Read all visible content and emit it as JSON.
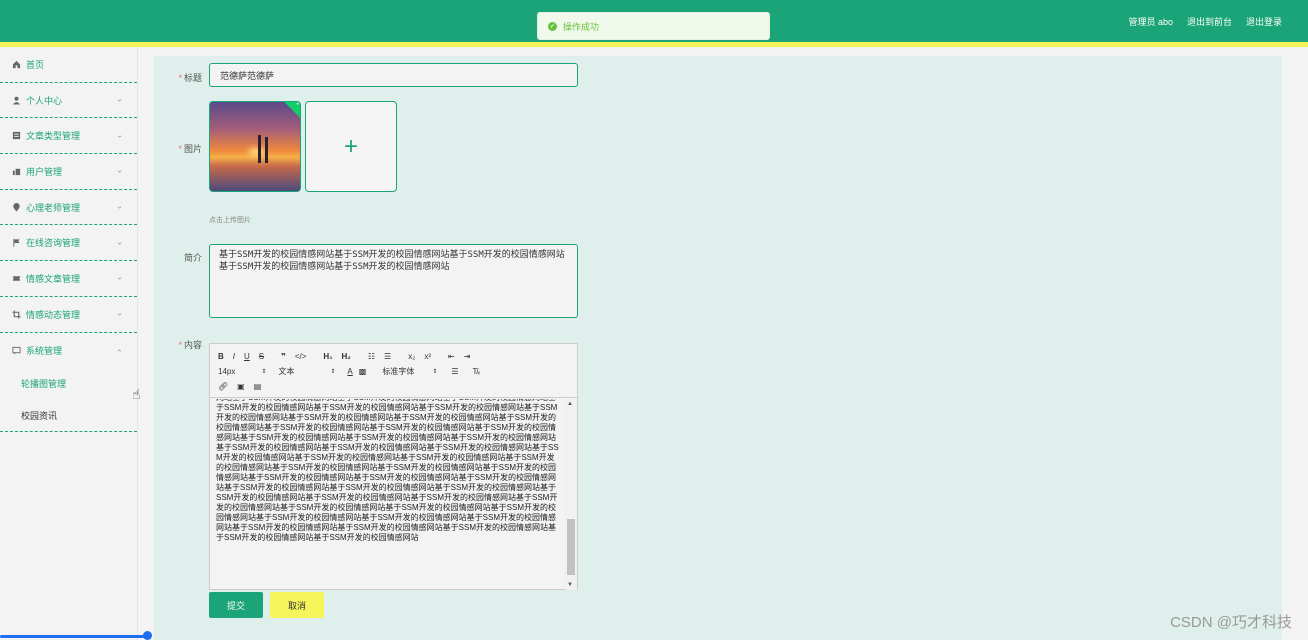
{
  "header": {
    "user_label": "管理员 abo",
    "back_to_front": "退出到前台",
    "logout": "退出登录"
  },
  "toast": {
    "message": "操作成功"
  },
  "sidebar": {
    "items": [
      {
        "label": "首页",
        "icon": "home-icon"
      },
      {
        "label": "个人中心",
        "icon": "user-icon"
      },
      {
        "label": "文章类型管理",
        "icon": "document-icon"
      },
      {
        "label": "用户管理",
        "icon": "users-icon"
      },
      {
        "label": "心理老师管理",
        "icon": "location-icon"
      },
      {
        "label": "在线咨询管理",
        "icon": "flag-icon"
      },
      {
        "label": "情感文章管理",
        "icon": "ticket-icon"
      },
      {
        "label": "情感动态管理",
        "icon": "crop-icon"
      },
      {
        "label": "系统管理",
        "icon": "message-icon"
      }
    ],
    "sub_items": [
      {
        "label": "轮播图管理"
      },
      {
        "label": "校园资讯"
      }
    ]
  },
  "form": {
    "title_label": "标题",
    "title_value": "范德萨范德萨",
    "image_label": "图片",
    "upload_hint": "点击上传图片",
    "summary_label": "简介",
    "summary_value": "基于SSM开发的校园情感网站基于SSM开发的校园情感网站基于SSM开发的校园情感网站基于SSM开发的校园情感网站基于SSM开发的校园情感网站",
    "content_label": "内容",
    "content_value": "网站基于SSM开发的校园情感网站基于SSM开发的校园情感网站基于SSM开发的校园情感网站基于SSM开发的校园情感网站基于SSM开发的校园情感网站基于SSM开发的校园情感网站基于SSM开发的校园情感网站基于SSM开发的校园情感网站基于SSM开发的校园情感网站基于SSM开发的校园情感网站基于SSM开发的校园情感网站基于SSM开发的校园情感网站基于SSM开发的校园情感网站基于SSM开发的校园情感网站基于SSM开发的校园情感网站基于SSM开发的校园情感网站基于SSM开发的校园情感网站基于SSM开发的校园情感网站基于SSM开发的校园情感网站基于SSM开发的校园情感网站基于SSM开发的校园情感网站基于SSM开发的校园情感网站基于SSM开发的校园情感网站基于SSM开发的校园情感网站基于SSM开发的校园情感网站基于SSM开发的校园情感网站基于SSM开发的校园情感网站基于SSM开发的校园情感网站基于SSM开发的校园情感网站基于SSM开发的校园情感网站基于SSM开发的校园情感网站基于SSM开发的校园情感网站基于SSM开发的校园情感网站基于SSM开发的校园情感网站基于SSM开发的校园情感网站基于SSM开发的校园情感网站基于SSM开发的校园情感网站基于SSM开发的校园情感网站基于SSM开发的校园情感网站基于SSM开发的校园情感网站基于SSM开发的校园情感网站基于SSM开发的校园情感网站基于SSM开发的校园情感网站基于SSM开发的校园情感网站基于SSM开发的校园情感网站基于SSM开发的校园情感网站基于SSM开发的校园情感网站",
    "toolbar": {
      "bold": "B",
      "italic": "I",
      "underline": "U",
      "strike": "S",
      "quote": "❞",
      "code": "</>",
      "h1": "H₁",
      "h2": "H₂",
      "size": "14px",
      "text_type": "文本",
      "font": "标准字体"
    },
    "submit_label": "提交",
    "cancel_label": "取消"
  },
  "watermark": "CSDN @巧才科技"
}
